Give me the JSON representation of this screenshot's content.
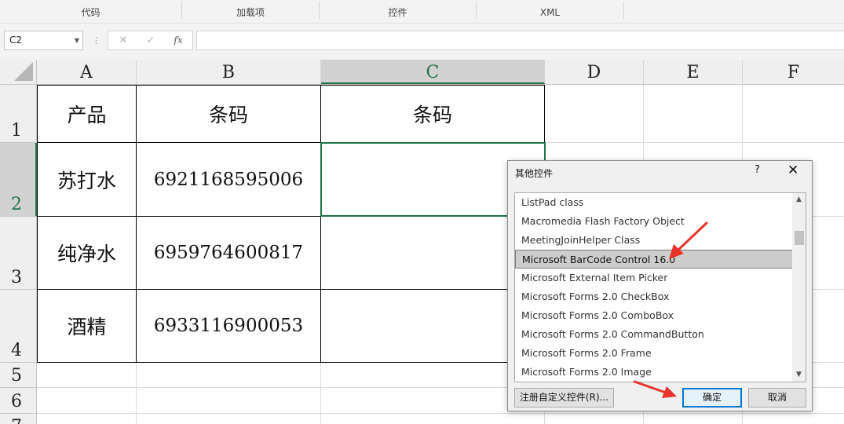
{
  "ribbon": {
    "groups": [
      "代码",
      "加载项",
      "控件",
      "XML"
    ]
  },
  "formula_bar": {
    "name_box": "C2",
    "cancel_glyph": "✕",
    "enter_glyph": "✓",
    "fx_label": "fx",
    "formula": ""
  },
  "sheet": {
    "columns": [
      "A",
      "B",
      "C",
      "D",
      "E",
      "F"
    ],
    "rows": [
      "1",
      "2",
      "3",
      "4",
      "5",
      "6",
      "7"
    ],
    "selected_cell": "C2",
    "table": {
      "header": [
        "产品",
        "条码",
        "条码"
      ],
      "body": [
        [
          "苏打水",
          "6921168595006",
          ""
        ],
        [
          "纯净水",
          "6959764600817",
          ""
        ],
        [
          "酒精",
          "6933116900053",
          ""
        ]
      ]
    }
  },
  "dialog": {
    "title": "其他控件",
    "help_glyph": "?",
    "close_glyph": "✕",
    "items": [
      "ListPad class",
      "Macromedia Flash Factory Object",
      "MeetingJoinHelper Class",
      "Microsoft BarCode Control 16.0",
      "Microsoft External Item Picker",
      "Microsoft Forms 2.0 CheckBox",
      "Microsoft Forms 2.0 ComboBox",
      "Microsoft Forms 2.0 CommandButton",
      "Microsoft Forms 2.0 Frame",
      "Microsoft Forms 2.0 Image"
    ],
    "selected_index": 3,
    "register_button": "注册自定义控件(R)...",
    "ok_button": "确定",
    "cancel_button": "取消"
  },
  "colors": {
    "accent_green": "#217346",
    "annotation_red": "#e8332a",
    "primary_button_border": "#0078d7"
  }
}
